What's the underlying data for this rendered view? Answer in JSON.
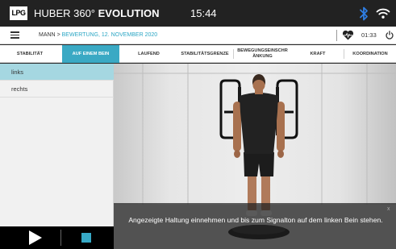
{
  "header": {
    "logo_text": "LPG",
    "brand_light": "HUBER 360°",
    "brand_bold": "EVOLUTION",
    "clock": "15:44",
    "icons": [
      "bluetooth-icon",
      "wifi-icon"
    ]
  },
  "breadcrumb": {
    "root": "MANN",
    "separator": ">",
    "current": "BEWERTUNG, 12. NOVEMBER 2020",
    "timer": "01:33",
    "icons": [
      "menu-icon",
      "heart-rate-icon",
      "power-icon"
    ],
    "accent_color": "#2aa6c4"
  },
  "tabs": [
    {
      "label": "STABILITÄT",
      "active": false
    },
    {
      "label": "AUF EINEM BEIN",
      "active": true
    },
    {
      "label": "LAUFEND",
      "active": false
    },
    {
      "label": "STABILITÄTSGRENZE",
      "active": false
    },
    {
      "label": "BEWEGUNGSEINSCHR ÄNKUNG",
      "active": false
    },
    {
      "label": "KRAFT",
      "active": false
    },
    {
      "label": "KOORDINATION",
      "active": false
    }
  ],
  "sidebar": {
    "items": [
      {
        "label": "links",
        "selected": true
      },
      {
        "label": "rechts",
        "selected": false
      }
    ]
  },
  "controls": {
    "icons": [
      "play-icon",
      "stop-icon"
    ],
    "stop_color": "#37a9c6"
  },
  "instruction": {
    "close": "x",
    "text": "Angezeigte Haltung einnehmen und bis zum Signalton auf dem linken Bein stehen."
  }
}
